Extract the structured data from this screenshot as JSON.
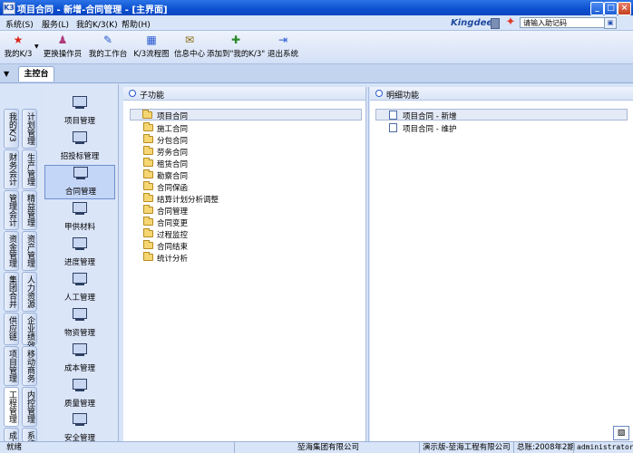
{
  "window": {
    "app_icon": "K3",
    "title": "项目合同 - 新增-合同管理 - [主界面]"
  },
  "menu": {
    "items": [
      "系统(S)",
      "服务(L)",
      "我的K/3(K)",
      "帮助(H)"
    ],
    "brand": "Kingdee",
    "help_placeholder": "请输入助记码"
  },
  "toolbar": {
    "items": [
      {
        "label": "我的K/3",
        "icon": "star-icon"
      },
      {
        "label": "更换操作员",
        "icon": "users-icon"
      },
      {
        "label": "我的工作台",
        "icon": "workbench-icon"
      },
      {
        "label": "K/3流程图",
        "icon": "flowchart-icon"
      },
      {
        "label": "信息中心",
        "icon": "message-icon"
      },
      {
        "label": "添加到\"我的K/3\"",
        "icon": "add-favorite-icon"
      },
      {
        "label": "退出系统",
        "icon": "exit-icon"
      }
    ]
  },
  "tabs": {
    "active": "主控台"
  },
  "side_tabs": {
    "col1": [
      "我的K/3",
      "财务会计",
      "管理会计",
      "资金管理",
      "集团合并",
      "供应链",
      "项目管理",
      "工程管理",
      "成本"
    ],
    "col2": [
      "计划管理",
      "生产管理",
      "精益管理",
      "资产管理",
      "人力资源",
      "企业绩效",
      "移动商务",
      "内控管理",
      "系统"
    ]
  },
  "modules": [
    "项目管理",
    "招投标管理",
    "合同管理",
    "甲供材料",
    "进度管理",
    "人工管理",
    "物资管理",
    "成本管理",
    "质量管理",
    "安全管理"
  ],
  "left_pane": {
    "header": "子功能",
    "items": [
      "项目合同",
      "施工合同",
      "分包合同",
      "劳务合同",
      "租赁合同",
      "勘察合同",
      "合同保函",
      "结算计划分析调整",
      "合同管理",
      "合同变更",
      "过程监控",
      "合同结束",
      "统计分析"
    ]
  },
  "right_pane": {
    "header": "明细功能",
    "items": [
      "项目合同 - 新增",
      "项目合同 - 维护"
    ]
  },
  "status": {
    "ready": "就绪",
    "company": "堃海集团有限公司",
    "edition": "演示版-堃海工程有限公司",
    "period": "总账:2008年2期",
    "user": "administrator"
  }
}
